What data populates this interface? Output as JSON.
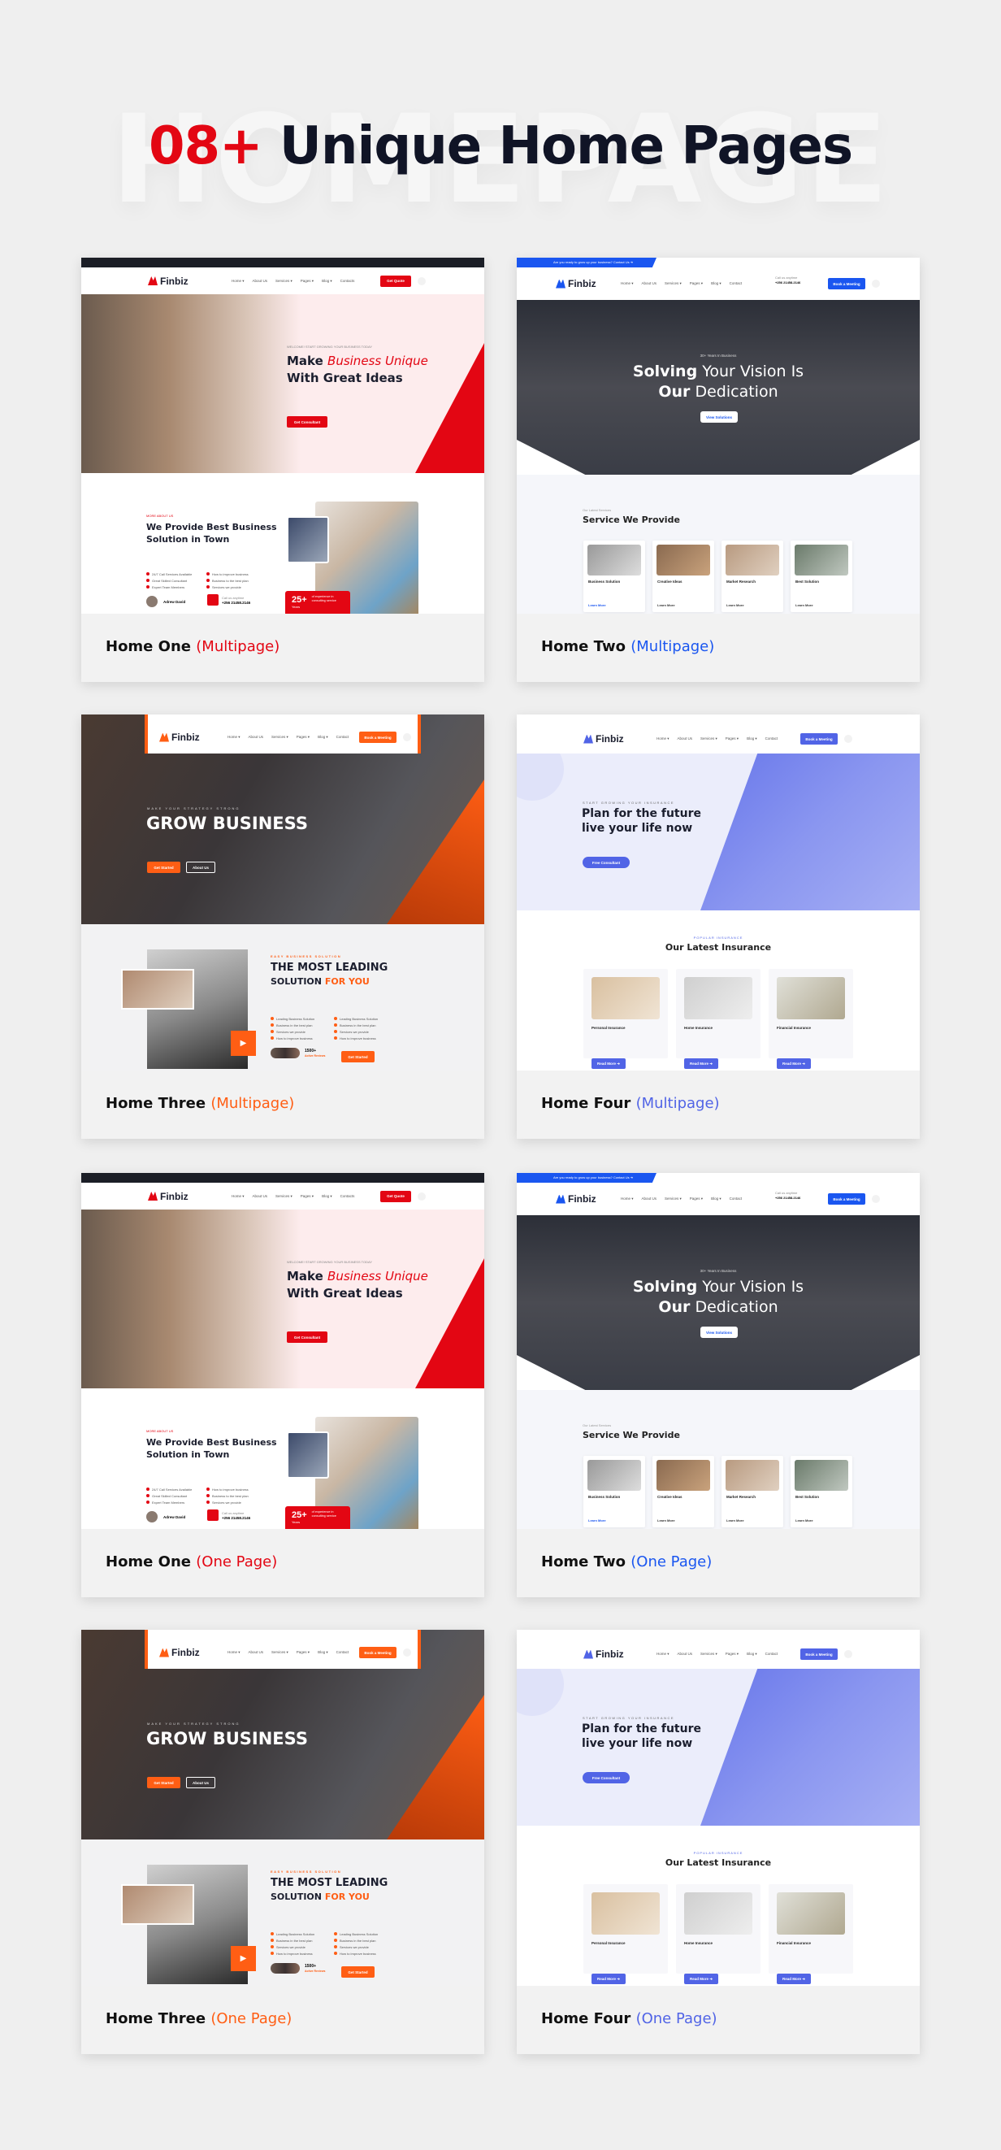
{
  "header": {
    "watermark": "HOMEPAGE",
    "count": "08+",
    "title": "Unique Home Pages"
  },
  "colors": {
    "one": "#e30613",
    "two": "#1a56f0",
    "three": "#ff5e14",
    "four": "#5164e6"
  },
  "demos": [
    {
      "name": "Home One",
      "type": "(Multipage)",
      "theme": "one"
    },
    {
      "name": "Home Two",
      "type": "(Multipage)",
      "theme": "two"
    },
    {
      "name": "Home Three",
      "type": "(Multipage)",
      "theme": "three"
    },
    {
      "name": "Home Four",
      "type": "(Multipage)",
      "theme": "four"
    },
    {
      "name": "Home One",
      "type": "(One Page)",
      "theme": "one"
    },
    {
      "name": "Home Two",
      "type": "(One Page)",
      "theme": "two"
    },
    {
      "name": "Home Three",
      "type": "(One Page)",
      "theme": "three"
    },
    {
      "name": "Home Four",
      "type": "(One Page)",
      "theme": "four"
    }
  ],
  "themes": {
    "one": {
      "logo": "Finbiz",
      "nav": [
        "Home ▾",
        "About Us",
        "Services ▾",
        "Pages ▾",
        "Blog ▾",
        "Contacts"
      ],
      "cta": "Get Quote",
      "tag": "WELCOME! START GROWING YOUR BUSINESS TODAY",
      "h1a": "Make",
      "h1b": "Business Unique",
      "h2": "With Great Ideas",
      "hero_btn": "Get Consultant",
      "about_tag": "MORE ABOUT US",
      "about_h1": "We Provide Best Business",
      "about_h2": "Solution in Town",
      "list": [
        "24/7 Call Services Available",
        "Great Skilled Consultant",
        "Expert Team Members",
        "How to improve business",
        "Business to the best plan",
        "Services we provide"
      ],
      "author": "Adrew David",
      "call_label": "Call us anytime",
      "phone": "+256 21458.2146",
      "badge_num": "25+",
      "badge_unit": "Years",
      "badge_text": "of experience in consulting service"
    },
    "two": {
      "logo": "Finbiz",
      "topbar": "Are you ready to grow up your business? Contact Us ➜",
      "nav": [
        "Home ▾",
        "About Us",
        "Services ▾",
        "Pages ▾",
        "Blog ▾",
        "Contact"
      ],
      "call_label": "Call us anytime",
      "phone": "+256 21458.2146",
      "cta": "Book a Meeting",
      "tag": "30+ Years In Business",
      "h1a": "Solving",
      "h1b": "Your Vision Is",
      "h2a": "Our",
      "h2b": "Dedication",
      "hero_btn": "View Solutions",
      "sec_tag": "Our Latest Services",
      "sec_title": "Service We Provide",
      "services": [
        "Business Solution",
        "Creative Ideas",
        "Market Research",
        "Best Solution"
      ],
      "learn": "Learn More"
    },
    "three": {
      "logo": "Finbiz",
      "nav": [
        "Home ▾",
        "About Us",
        "Services ▾",
        "Pages ▾",
        "Blog ▾",
        "Contact"
      ],
      "cta": "Book a Meeting",
      "tag": "MAKE YOUR STRATEGY STRONG",
      "h1": "GROW BUSINESS",
      "btn1": "Get Started",
      "btn2": "About Us",
      "sec_tag": "EASY BUSINESS SOLUTION",
      "sec_h1": "THE MOST LEADING",
      "sec_h2a": "SOLUTION",
      "sec_h2b": "FOR YOU",
      "list": [
        "Leading Business Solution",
        "Business in the best plan",
        "Services we provide",
        "How to improve business"
      ],
      "reviews": "1500+",
      "reviews_label": "Active Reviews",
      "btn3": "Get Started"
    },
    "four": {
      "logo": "Finbiz",
      "nav": [
        "Home ▾",
        "About Us",
        "Services ▾",
        "Pages ▾",
        "Blog ▾",
        "Contact"
      ],
      "cta": "Book a Meeting",
      "tag": "START GROWING YOUR INSURANCE",
      "h1": "Plan for the future",
      "h2": "live your life now",
      "hero_btn": "Free Consultant",
      "sec_tag": "POPULAR INSURANCE",
      "sec_title": "Our Latest Insurance",
      "items": [
        "Personal Insurance",
        "Home Insurance",
        "Financial Insurance"
      ],
      "read": "Read More ➜"
    }
  }
}
